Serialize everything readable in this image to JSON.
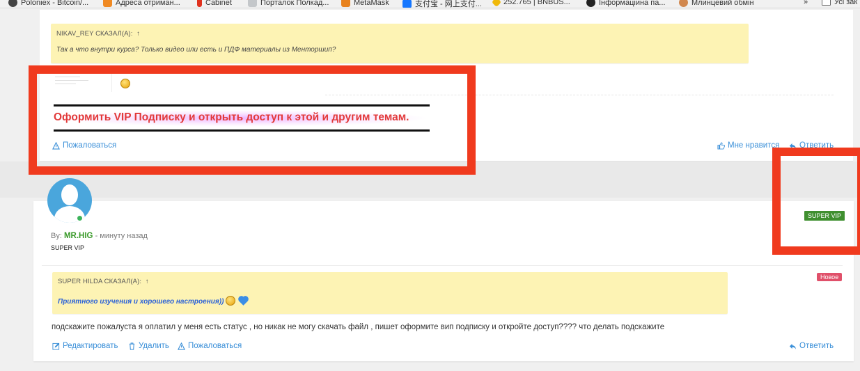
{
  "bookmarks": [
    {
      "label": "Poloniex - Bitcoin/...",
      "icon": "poloniex-icon",
      "color": "#333333"
    },
    {
      "label": "Адреса отриман...",
      "icon": "rss-icon",
      "color": "#f08a24"
    },
    {
      "label": "Cabinet",
      "icon": "cabinet-icon",
      "color": "#e0321e"
    },
    {
      "label": "Порталок Полкад...",
      "icon": "grid-icon",
      "color": "#9aa0a6"
    },
    {
      "label": "MetaMask",
      "icon": "metamask-fox-icon",
      "color": "#e8821e"
    },
    {
      "label": "支付宝 - 网上支付...",
      "icon": "alipay-icon",
      "color": "#1677ff"
    },
    {
      "label": "252.765 | BNBUS...",
      "icon": "binance-icon",
      "color": "#f0b90b"
    },
    {
      "label": "Інформаціина па...",
      "icon": "c-icon",
      "color": "#222222"
    },
    {
      "label": "Млинцевий обмін",
      "icon": "pancake-icon",
      "color": "#d1884f"
    }
  ],
  "bookmarks_more": "»",
  "bookmarks_folder": "Усі зак",
  "post1": {
    "quote_author": "NIKAV_REY СКАЗАЛ(А):",
    "quote_arrow": "↑",
    "quote_text": "Так а что внутри курса? Только видео или есть и ПДФ материалы из Менторшип?",
    "vip_message": "Оформить VIP Подписку и открыть доступ к этой и другим темам.",
    "report": "Пожаловаться",
    "like": "Мне нравится",
    "reply": "Ответить"
  },
  "post2": {
    "by_label": "By:",
    "author": "MR.HIG",
    "separator": "-",
    "time": "минуту назад",
    "rank": "SUPER VIP",
    "badge": "SUPER VIP",
    "new_badge": "Новое",
    "quote_author": "SUPER HILDA СКАЗАЛ(А):",
    "quote_arrow": "↑",
    "quote_text": "Приятного изучения и хорошего настроения))",
    "message": "подскажите пожалуста я оплатил у меня есть статус , но никак не могу скачать файл , пишет оформите вип подписку и откройте доступ???? что делать подскажите",
    "edit": "Редактировать",
    "delete": "Удалить",
    "report": "Пожаловаться",
    "reply": "Ответить"
  },
  "colors": {
    "link": "#3a8fd8",
    "annotation_red": "#f03a1e",
    "vip_red": "#e23a3a",
    "quote_bg": "#fdf3b4",
    "author_green": "#3a9a2a"
  }
}
